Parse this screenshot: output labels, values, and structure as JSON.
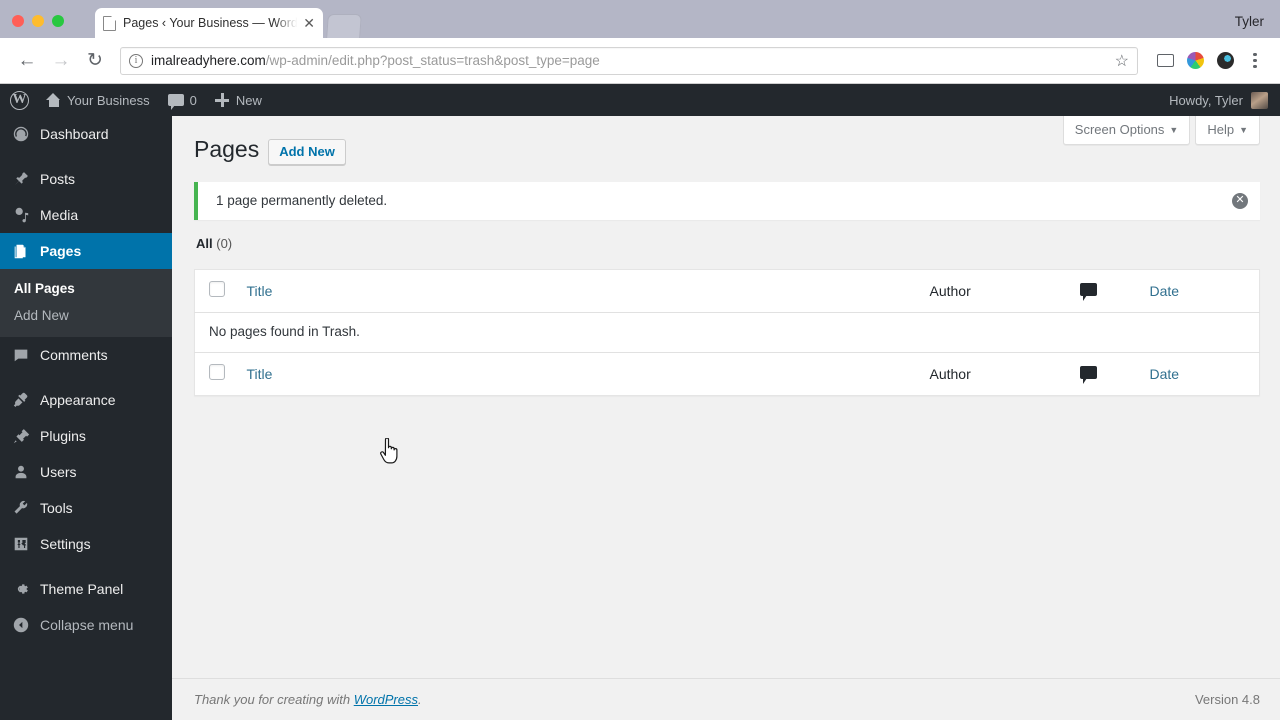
{
  "browser": {
    "tab": {
      "title": "Pages ‹ Your Business — Word",
      "close_label": "✕",
      "favicon": "page-icon"
    },
    "window_user": "Tyler",
    "nav": {
      "back": "←",
      "forward": "→",
      "reload": "↻"
    },
    "omnibox": {
      "info_glyph": "i",
      "url_domain": "imalreadyhere.com",
      "url_path": "/wp-admin/edit.php?post_status=trash&post_type=page",
      "star": "☆"
    },
    "extensions": [
      "cast-icon",
      "color-wheel-icon",
      "dark-circle-icon",
      "kebab-menu-icon"
    ]
  },
  "adminbar": {
    "logo": "W",
    "site_name": "Your Business",
    "comment_count": "0",
    "new_label": "New",
    "howdy": "Howdy, Tyler"
  },
  "sidebar": {
    "items": [
      {
        "label": "Dashboard",
        "icon": "dashboard-icon",
        "current": false
      },
      {
        "label": "Posts",
        "icon": "pin-icon",
        "current": false
      },
      {
        "label": "Media",
        "icon": "media-icon",
        "current": false
      },
      {
        "label": "Pages",
        "icon": "pages-icon",
        "current": true
      },
      {
        "label": "Comments",
        "icon": "comments-icon",
        "current": false
      },
      {
        "label": "Appearance",
        "icon": "brush-icon",
        "current": false
      },
      {
        "label": "Plugins",
        "icon": "plug-icon",
        "current": false
      },
      {
        "label": "Users",
        "icon": "user-icon",
        "current": false
      },
      {
        "label": "Tools",
        "icon": "wrench-icon",
        "current": false
      },
      {
        "label": "Settings",
        "icon": "settings-icon",
        "current": false
      },
      {
        "label": "Theme Panel",
        "icon": "gear-icon",
        "current": false
      }
    ],
    "submenu": [
      {
        "label": "All Pages",
        "current": true
      },
      {
        "label": "Add New",
        "current": false
      }
    ],
    "collapse": {
      "label": "Collapse menu",
      "icon": "collapse-arrow-icon"
    }
  },
  "screen_meta": {
    "screen_options": "Screen Options",
    "help": "Help",
    "caret": "▼"
  },
  "page": {
    "title": "Pages",
    "add_new": "Add New",
    "notice": {
      "message": "1 page permanently deleted.",
      "dismiss_glyph": "✕",
      "accent_color": "#46b450"
    },
    "filters": {
      "all_label": "All",
      "all_count": "(0)"
    }
  },
  "table": {
    "columns": {
      "title": "Title",
      "author": "Author",
      "comments": "comments-bubble-icon",
      "date": "Date"
    },
    "empty_message": "No pages found in Trash.",
    "rows": []
  },
  "footer": {
    "thanks_prefix": "Thank you for creating with ",
    "link": "WordPress",
    "thanks_suffix": ".",
    "version": "Version 4.8"
  }
}
